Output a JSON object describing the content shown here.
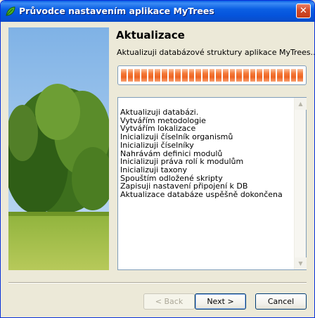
{
  "window": {
    "title": "Průvodce nastavením aplikace MyTrees",
    "close_glyph": "✕"
  },
  "page": {
    "title": "Aktualizace",
    "subtitle": "Aktualizuji databázové struktury aplikace MyTrees..."
  },
  "progress": {
    "fraction": 1.0,
    "color": "#ee6423"
  },
  "log": {
    "lines": [
      "Aktualizuji databázi.",
      "Vytvářím metodologie",
      "Vytvářím lokalizace",
      "Inicializuji číselník organismů",
      "Inicializuji číselníky",
      "Nahrávám definici modulů",
      "Inicializuji práva rolí k modulům",
      "Inicializuji taxony",
      "Spouštím odložené skripty",
      "Zapisuji nastavení připojení k DB",
      "Aktualizace databáze uspěšně dokončena"
    ]
  },
  "buttons": {
    "back": "< Back",
    "next": "Next >",
    "cancel": "Cancel"
  },
  "icons": {
    "app": "leaf-icon",
    "close": "close-icon",
    "scroll_up": "arrow-up-icon",
    "scroll_down": "arrow-down-icon"
  }
}
